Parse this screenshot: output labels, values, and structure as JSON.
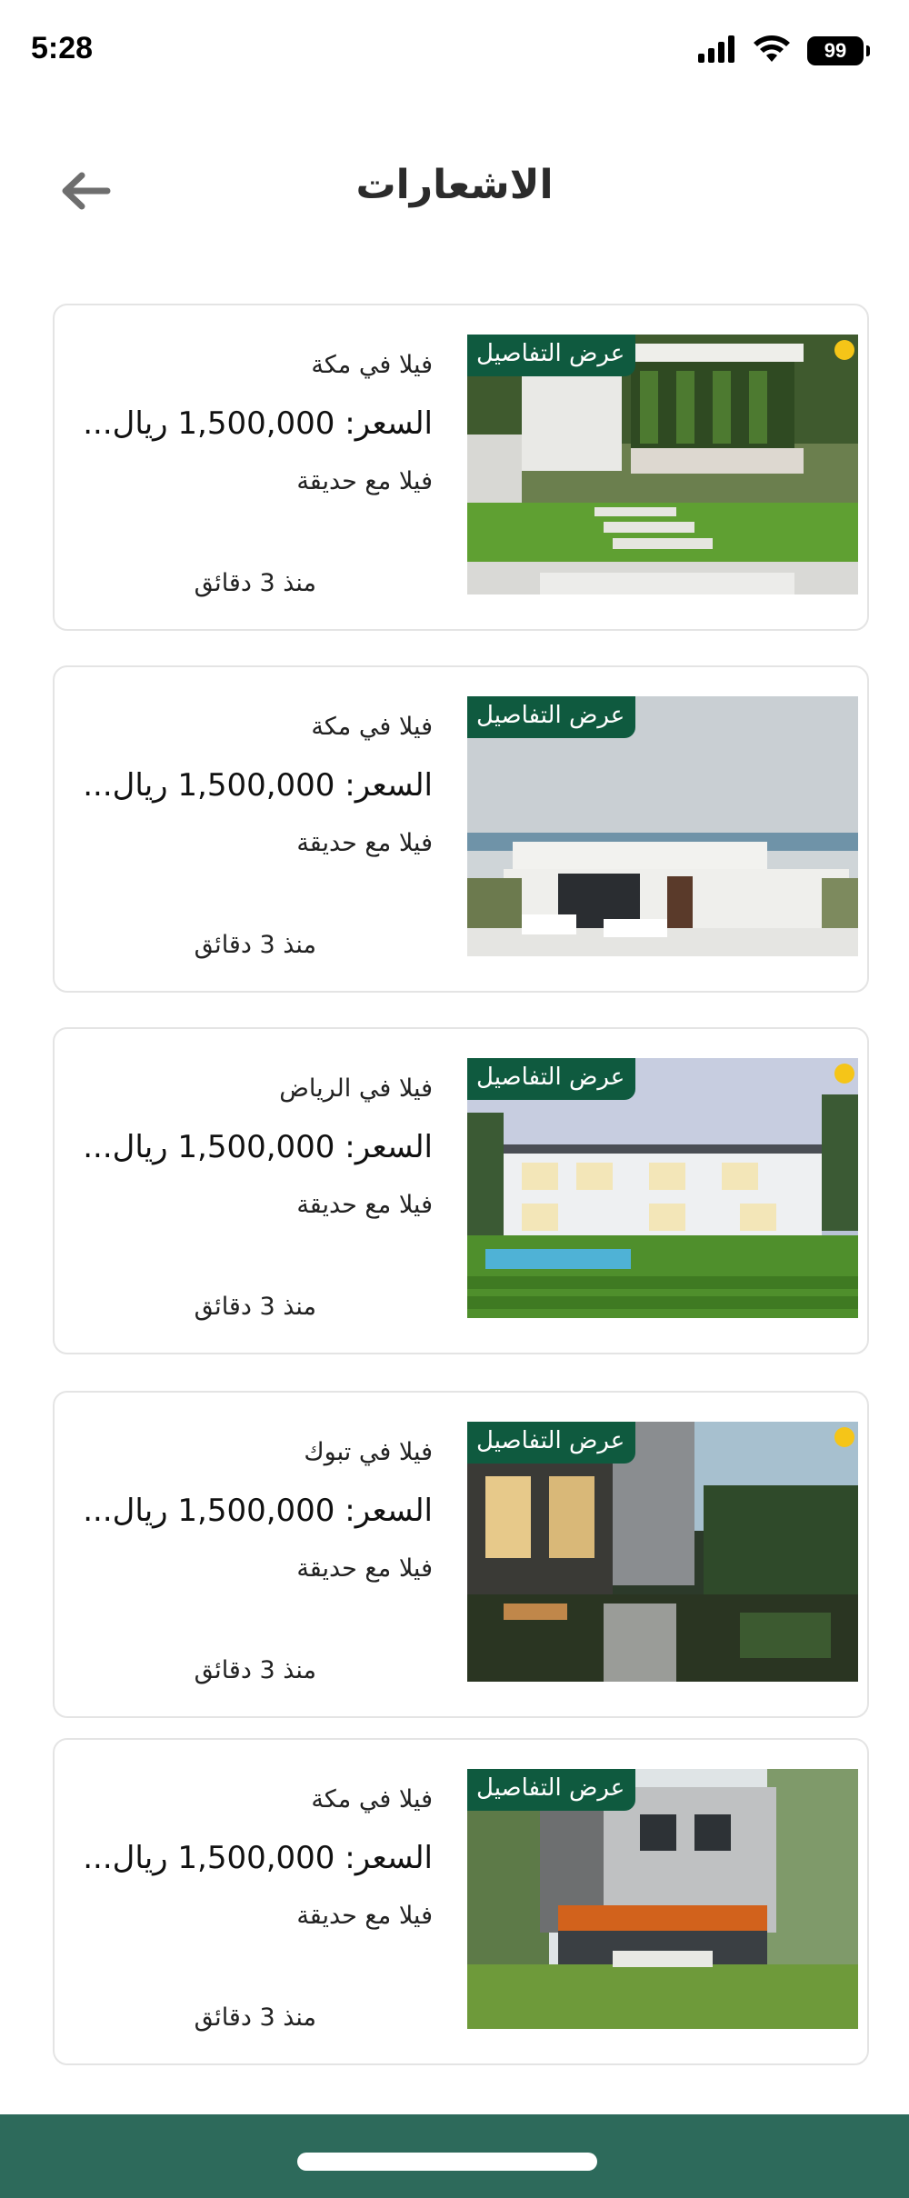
{
  "status_bar": {
    "time": "5:28",
    "battery": "99",
    "icons": [
      "signal-icon",
      "wifi-icon",
      "battery-icon"
    ]
  },
  "header": {
    "title": "الاشعارات",
    "back_icon": "arrow-left-icon"
  },
  "colors": {
    "accent": "#0f5a3f",
    "bottom_bar": "#2d6a5b",
    "unread_dot": "#f5c518",
    "card_border": "#e4e4e4"
  },
  "notifications": [
    {
      "badge": "عرض التفاصيل",
      "title": "فيلا في مكة",
      "price": "السعر: 1,500,000 ريال...",
      "description": "فيلا مع حديقة",
      "time": "منذ 3 دقائق",
      "unread": true
    },
    {
      "badge": "عرض التفاصيل",
      "title": "فيلا في مكة",
      "price": "السعر: 1,500,000 ريال...",
      "description": "فيلا مع حديقة",
      "time": "منذ 3 دقائق",
      "unread": false
    },
    {
      "badge": "عرض التفاصيل",
      "title": "فيلا في الرياض",
      "price": "السعر: 1,500,000 ريال...",
      "description": "فيلا مع حديقة",
      "time": "منذ 3 دقائق",
      "unread": true
    },
    {
      "badge": "عرض التفاصيل",
      "title": "فيلا في تبوك",
      "price": "السعر: 1,500,000 ريال...",
      "description": "فيلا مع حديقة",
      "time": "منذ 3 دقائق",
      "unread": true
    },
    {
      "badge": "عرض التفاصيل",
      "title": "فيلا في مكة",
      "price": "السعر: 1,500,000 ريال...",
      "description": "فيلا مع حديقة",
      "time": "منذ 3 دقائق",
      "unread": false
    }
  ]
}
